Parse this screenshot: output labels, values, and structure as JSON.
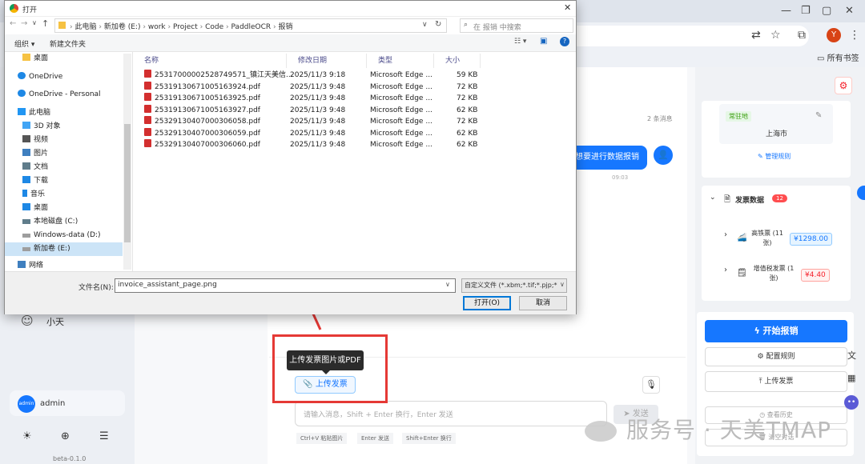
{
  "browser": {
    "bookmarks_label": "所有书签",
    "profile_letter": "Y"
  },
  "app": {
    "message_count": "2 条消息",
    "user_message": "想要进行数据报销",
    "user_message_time": "09:03",
    "assistant_name": "小天",
    "username": "admin",
    "avatar_label": "admin",
    "version": "beta-0.1.0",
    "upload_tooltip": "上传发票图片或PDF",
    "upload_button": "上传发票",
    "input_placeholder": "请输入消息，Shift + Enter 换行，Enter 发送",
    "send_button": "发送",
    "hints": [
      "Ctrl+V 粘贴图片",
      "Enter 发送",
      "Shift+Enter 换行"
    ],
    "location_tag": "常驻地",
    "location_value": "上海市",
    "manage_rules": "管理规则",
    "invoice_data_label": "发票数据",
    "invoice_count": "12",
    "invoice_types": [
      {
        "name": "高铁票 (11张)",
        "amount": "¥1298.00"
      },
      {
        "name": "增值税发票 (1张)",
        "amount": "¥4.40"
      }
    ],
    "start_button": "开始报销",
    "config_button": "配置规则",
    "upload_invoice_button": "上传发票",
    "history_button": "查看历史",
    "clear_button": "清空对话"
  },
  "dialog": {
    "title": "打开",
    "path": [
      "此电脑",
      "新加卷 (E:)",
      "work",
      "Project",
      "Code",
      "PaddleOCR",
      "报销"
    ],
    "search_placeholder": "在 报销 中搜索",
    "organize": "组织 ▾",
    "new_folder": "新建文件夹",
    "nav": [
      {
        "label": "桌面",
        "icon": "folder-icon",
        "color": "#f6c242"
      },
      {
        "label": "OneDrive",
        "icon": "cloud-icon",
        "color": "#1e88e5"
      },
      {
        "label": "OneDrive - Personal",
        "icon": "cloud-icon",
        "color": "#1e88e5"
      },
      {
        "label": "此电脑",
        "icon": "computer-icon",
        "color": "#2196f3"
      },
      {
        "label": "3D 对象",
        "icon": "cube-icon",
        "color": "#42a5f5"
      },
      {
        "label": "视频",
        "icon": "video-icon",
        "color": "#555555"
      },
      {
        "label": "图片",
        "icon": "picture-icon",
        "color": "#3f7fbf"
      },
      {
        "label": "文档",
        "icon": "document-icon",
        "color": "#607d8b"
      },
      {
        "label": "下载",
        "icon": "download-icon",
        "color": "#1e88e5"
      },
      {
        "label": "音乐",
        "icon": "music-icon",
        "color": "#1e88e5"
      },
      {
        "label": "桌面",
        "icon": "desktop-icon",
        "color": "#1e88e5"
      },
      {
        "label": "本地磁盘 (C:)",
        "icon": "drive-icon",
        "color": "#607d8b"
      },
      {
        "label": "Windows-data (D:)",
        "icon": "drive-icon",
        "color": "#9e9e9e"
      },
      {
        "label": "新加卷 (E:)",
        "icon": "drive-icon",
        "color": "#9e9e9e"
      },
      {
        "label": "网络",
        "icon": "network-icon",
        "color": "#3f7fbf"
      }
    ],
    "columns": [
      "名称",
      "修改日期",
      "类型",
      "大小"
    ],
    "files": [
      {
        "name": "25317000002528749571_镇江天美信...",
        "date": "2025/11/3 9:18",
        "type": "Microsoft Edge ...",
        "size": "59 KB"
      },
      {
        "name": "25319130671005163924.pdf",
        "date": "2025/11/3 9:48",
        "type": "Microsoft Edge ...",
        "size": "72 KB"
      },
      {
        "name": "25319130671005163925.pdf",
        "date": "2025/11/3 9:48",
        "type": "Microsoft Edge ...",
        "size": "72 KB"
      },
      {
        "name": "25319130671005163927.pdf",
        "date": "2025/11/3 9:48",
        "type": "Microsoft Edge ...",
        "size": "62 KB"
      },
      {
        "name": "25329130407000306058.pdf",
        "date": "2025/11/3 9:48",
        "type": "Microsoft Edge ...",
        "size": "72 KB"
      },
      {
        "name": "25329130407000306059.pdf",
        "date": "2025/11/3 9:48",
        "type": "Microsoft Edge ...",
        "size": "62 KB"
      },
      {
        "name": "25329130407000306060.pdf",
        "date": "2025/11/3 9:48",
        "type": "Microsoft Edge ...",
        "size": "62 KB"
      }
    ],
    "filename_label": "文件名(N):",
    "filename_value": "invoice_assistant_page.png",
    "filter_value": "自定义文件 (*.xbm;*.tif;*.pjp;*",
    "open_button": "打开(O)",
    "cancel_button": "取消"
  },
  "watermark": "服务号 · 天美TMAP"
}
